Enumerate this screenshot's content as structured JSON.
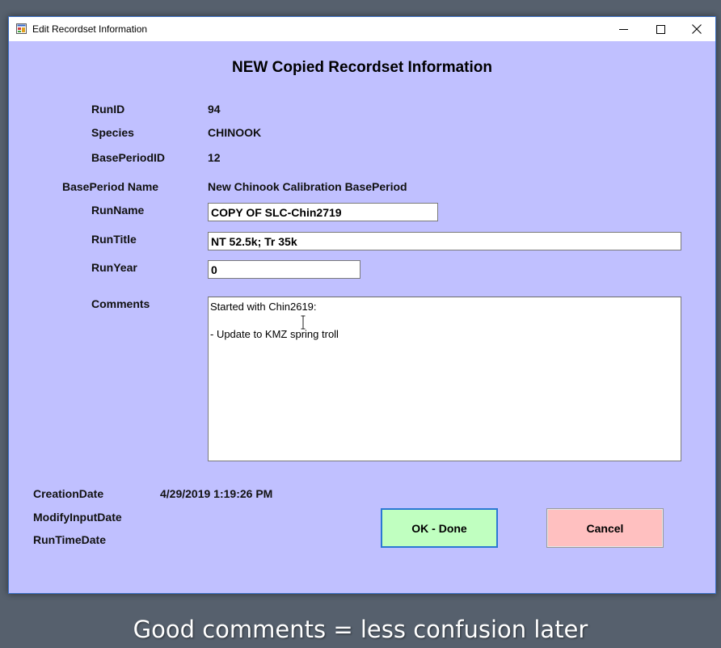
{
  "window": {
    "title": "Edit Recordset Information",
    "heading": "NEW Copied Recordset Information"
  },
  "fields": {
    "run_id_label": "RunID",
    "run_id_value": "94",
    "species_label": "Species",
    "species_value": "CHINOOK",
    "base_period_id_label": "BasePeriodID",
    "base_period_id_value": "12",
    "base_period_name_label": "BasePeriod Name",
    "base_period_name_value": "New Chinook Calibration BasePeriod",
    "run_name_label": "RunName",
    "run_name_value": "COPY OF SLC-Chin2719",
    "run_title_label": "RunTitle",
    "run_title_value": "NT 52.5k; Tr 35k",
    "run_year_label": "RunYear",
    "run_year_value": "0",
    "comments_label": "Comments",
    "comments_value": "Started with Chin2619:\n\n- Update to KMZ spring troll"
  },
  "dates": {
    "creation_label": "CreationDate",
    "creation_value": "4/29/2019 1:19:26 PM",
    "modify_input_label": "ModifyInputDate",
    "run_time_label": "RunTimeDate"
  },
  "buttons": {
    "ok_label": "OK - Done",
    "cancel_label": "Cancel"
  },
  "caption": "Good comments = less confusion later",
  "icons": {
    "app": "app-window-icon",
    "minimize": "minimize-icon",
    "maximize": "maximize-icon",
    "close": "close-icon",
    "cursor": "text-cursor-icon"
  },
  "colors": {
    "form_background": "#c0c0ff",
    "ok_button": "#c0ffc0",
    "cancel_button": "#ffc0c0",
    "desktop": "#56606d"
  }
}
